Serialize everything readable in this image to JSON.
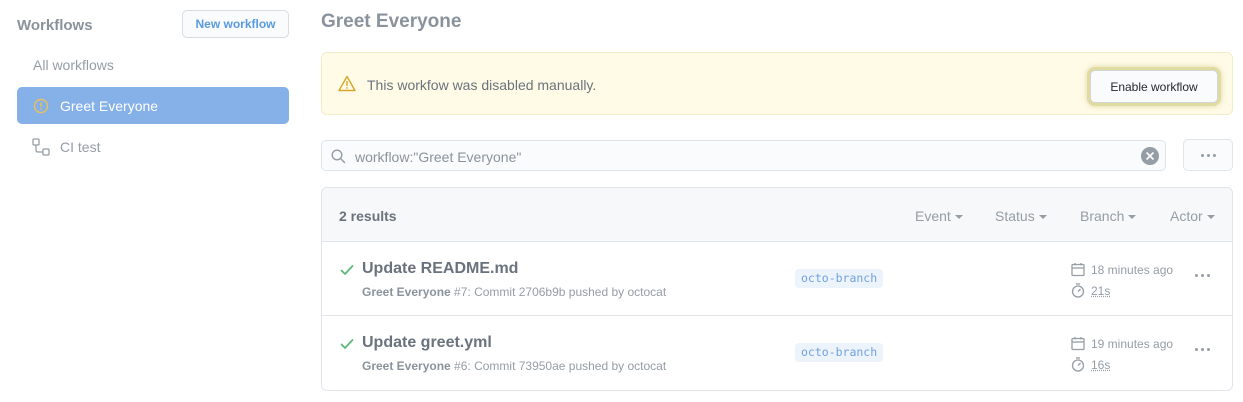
{
  "sidebar": {
    "title": "Workflows",
    "new_button": "New workflow",
    "items": [
      {
        "label": "All workflows"
      },
      {
        "label": "Greet Everyone",
        "icon": "warning-circle-icon"
      },
      {
        "label": "CI test",
        "icon": "workflow-icon"
      }
    ]
  },
  "main": {
    "title": "Greet Everyone",
    "banner": {
      "message": "This workfow was disabled manually.",
      "button": "Enable workflow",
      "icon": "alert-icon"
    },
    "search": {
      "value": "workflow:\"Greet Everyone\""
    },
    "results": {
      "count": "2 results",
      "filters": [
        "Event",
        "Status",
        "Branch",
        "Actor"
      ],
      "runs": [
        {
          "title": "Update README.md",
          "workflow": "Greet Everyone",
          "detail": " #7: Commit 2706b9b pushed by octocat",
          "branch": "octo-branch",
          "time": "18 minutes ago",
          "duration": "21s"
        },
        {
          "title": "Update greet.yml",
          "workflow": "Greet Everyone",
          "detail": " #6: Commit 73950ae pushed by octocat",
          "branch": "octo-branch",
          "time": "19 minutes ago",
          "duration": "16s"
        }
      ]
    }
  },
  "colors": {
    "active_item": "#85b0e8",
    "banner_bg": "#fffbe6",
    "success_check": "#5fb87a",
    "link_blue": "#5a9ae0"
  }
}
